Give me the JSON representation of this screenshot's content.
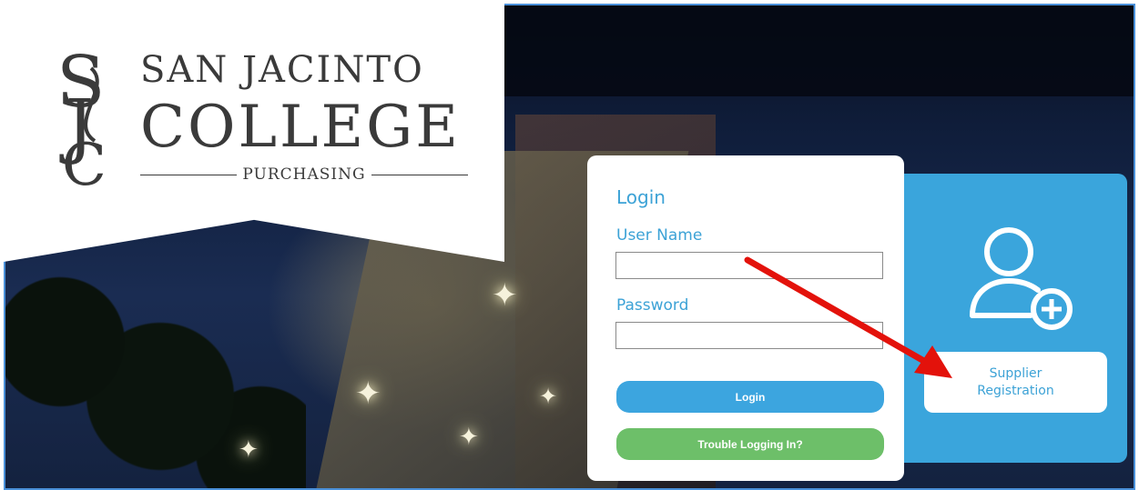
{
  "logo": {
    "line1": "SAN JACINTO",
    "line2": "COLLEGE",
    "line3": "PURCHASING",
    "monogram": "SJC"
  },
  "login": {
    "title": "Login",
    "username_label": "User Name",
    "username_value": "",
    "password_label": "Password",
    "password_value": "",
    "login_button": "Login",
    "trouble_button": "Trouble Logging In?"
  },
  "supplier": {
    "icon": "user-add-icon",
    "button_label": "Supplier\nRegistration"
  },
  "colors": {
    "accent_blue": "#3ca5df",
    "trouble_green": "#6dbf69",
    "annotation_arrow": "#e3120b"
  }
}
